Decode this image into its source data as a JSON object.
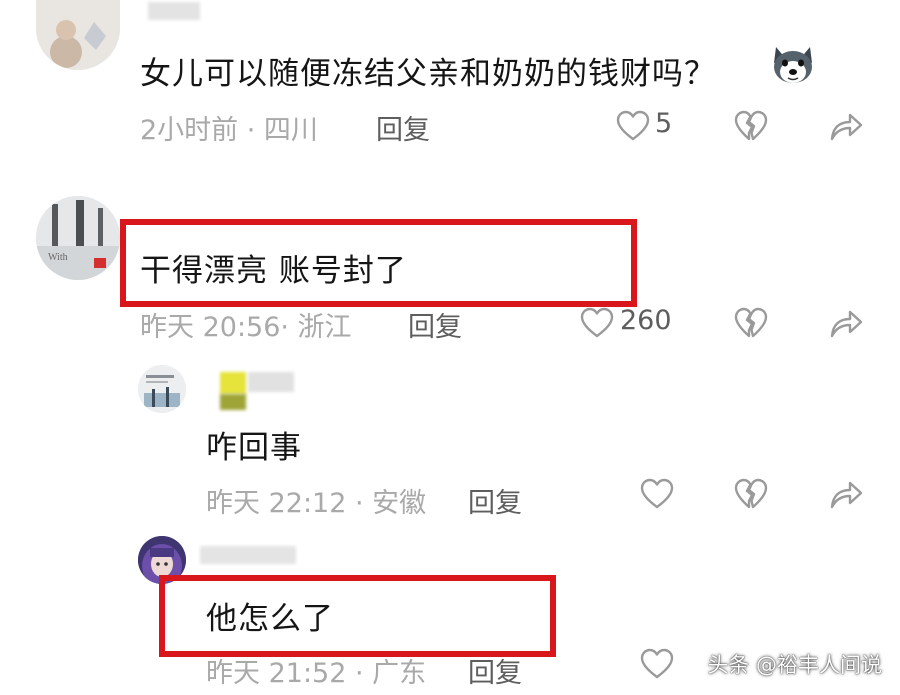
{
  "comments": [
    {
      "text": "女儿可以随便冻结父亲和奶奶的钱财吗？",
      "emoji": "husky-dog-emoji",
      "meta": "2小时前 · 四川",
      "reply": "回复",
      "likes": "5"
    },
    {
      "text": "干得漂亮 账号封了",
      "meta": "昨天 20:56· 浙江",
      "reply": "回复",
      "likes": "260",
      "avatar_caption": "With"
    },
    {
      "text": "咋回事",
      "meta": "昨天 22:12 · 安徽",
      "reply": "回复"
    },
    {
      "text": "他怎么了",
      "meta": "昨天 21:52 · 广东",
      "reply": "回复"
    }
  ],
  "watermark": "头条 @裕丰人间说",
  "colors": {
    "highlight": "#d8161b",
    "meta": "#a9a9a9",
    "action": "#5e5e5e"
  },
  "icons": [
    "heart-icon",
    "broken-heart-icon",
    "share-icon"
  ]
}
